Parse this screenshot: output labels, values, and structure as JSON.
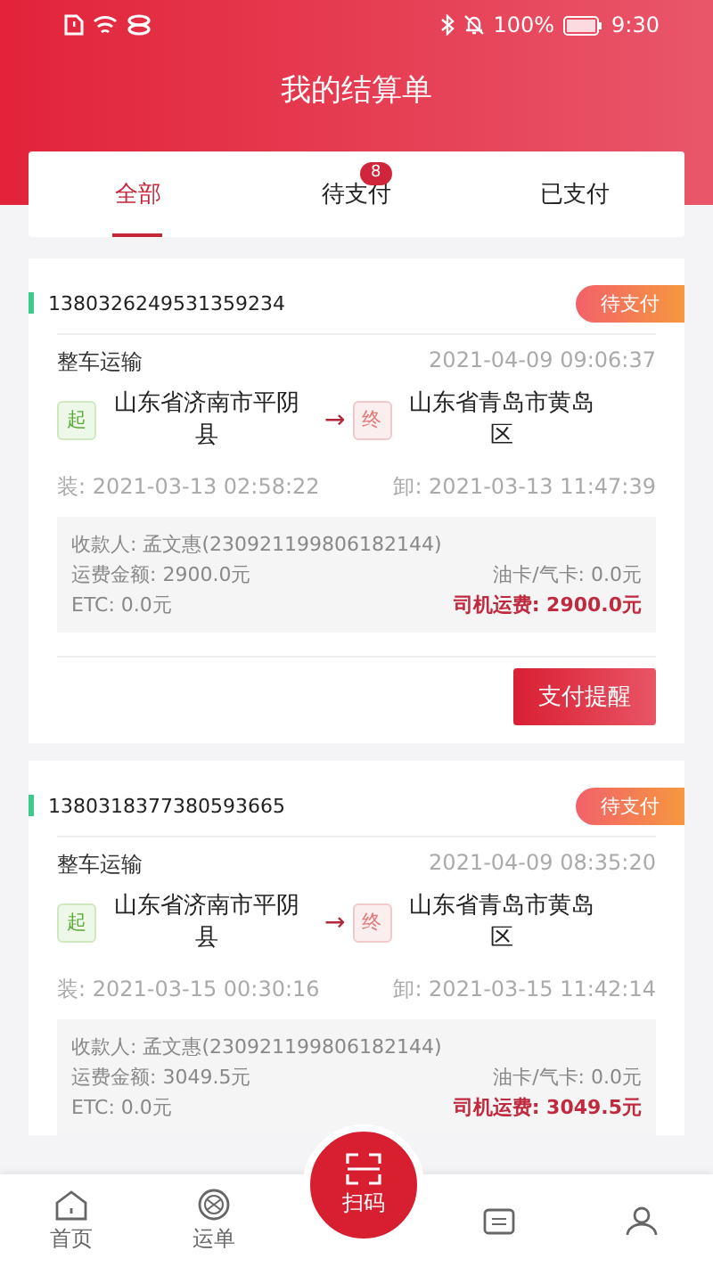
{
  "status_bar": {
    "battery": "100%",
    "time": "9:30"
  },
  "header": {
    "title": "我的结算单"
  },
  "tabs": [
    {
      "label": "全部",
      "selected": true
    },
    {
      "label": "待支付",
      "selected": false,
      "badge": "8"
    },
    {
      "label": "已支付",
      "selected": false
    }
  ],
  "orders": [
    {
      "order_no": "1380326249531359234",
      "status": "待支付",
      "type": "整车运输",
      "time": "2021-04-09 09:06:37",
      "start_tag": "起",
      "from": "山东省济南市平阴县",
      "arrow": "→",
      "end_tag": "终",
      "to": "山东省青岛市黄岛区",
      "load": "装: 2021-03-13 02:58:22",
      "unload": "卸: 2021-03-13 11:47:39",
      "payee": "收款人: 孟文惠(230921199806182144)",
      "freight": "运费金额: 2900.0元",
      "fuel_card": "油卡/气卡: 0.0元",
      "etc": "ETC: 0.0元",
      "driver_fee": "司机运费: 2900.0元",
      "button": "支付提醒"
    },
    {
      "order_no": "1380318377380593665",
      "status": "待支付",
      "type": "整车运输",
      "time": "2021-04-09 08:35:20",
      "start_tag": "起",
      "from": "山东省济南市平阴县",
      "arrow": "→",
      "end_tag": "终",
      "to": "山东省青岛市黄岛区",
      "load": "装: 2021-03-15 00:30:16",
      "unload": "卸: 2021-03-15 11:42:14",
      "payee": "收款人: 孟文惠(230921199806182144)",
      "freight": "运费金额: 3049.5元",
      "fuel_card": "油卡/气卡: 0.0元",
      "etc": "ETC: 0.0元",
      "driver_fee": "司机运费: 3049.5元"
    }
  ],
  "bottom_nav": [
    {
      "kind": "home",
      "label": "首页"
    },
    {
      "kind": "waybill",
      "label": "运单"
    },
    {
      "kind": "scan",
      "label": "扫码"
    },
    {
      "kind": "wallet"
    },
    {
      "kind": "user"
    }
  ]
}
